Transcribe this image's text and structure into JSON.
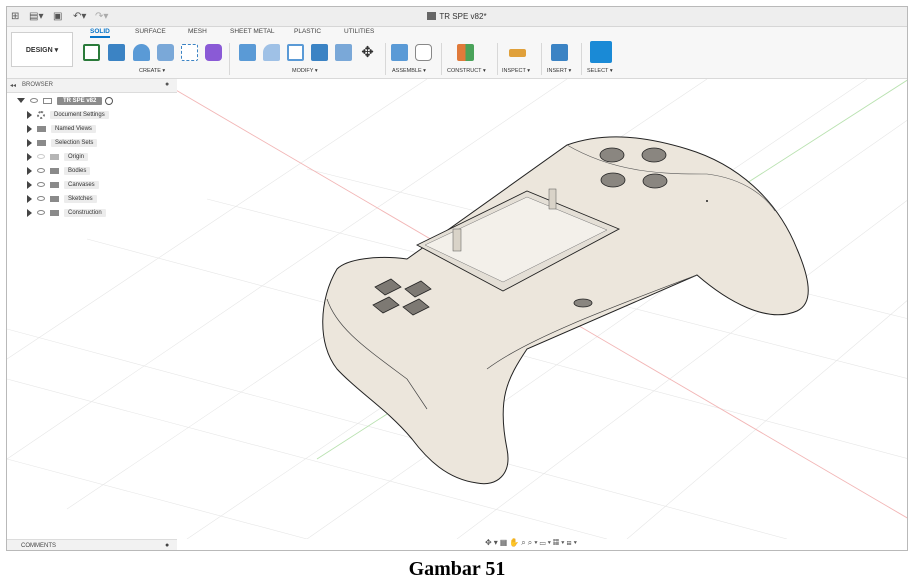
{
  "app": {
    "doc_title": "TR SPE v82*"
  },
  "toolbar": {
    "design_label": "DESIGN ▾",
    "tabs": [
      "SOLID",
      "SURFACE",
      "MESH",
      "SHEET METAL",
      "PLASTIC",
      "UTILITIES"
    ],
    "groups": [
      "CREATE ▾",
      "MODIFY ▾",
      "ASSEMBLE ▾",
      "CONSTRUCT ▾",
      "INSPECT ▾",
      "INSERT ▾",
      "SELECT ▾"
    ]
  },
  "browser": {
    "header": "BROWSER",
    "root": "TR SPE v82",
    "items": [
      "Document Settings",
      "Named Views",
      "Selection Sets",
      "Origin",
      "Bodies",
      "Canvases",
      "Sketches",
      "Construction"
    ]
  },
  "footer": {
    "comments_label": "COMMENTS"
  },
  "caption": "Gambar 51",
  "colors": {
    "accent": "#0a76c9",
    "model_body": "#ece6dc",
    "axis_red": "#f2b6b6",
    "axis_green": "#b9e2b0"
  },
  "icons": [
    "grid-icon",
    "file-icon",
    "save-icon",
    "undo-icon",
    "redo-icon",
    "gear-icon",
    "eye-icon",
    "folder-icon"
  ]
}
